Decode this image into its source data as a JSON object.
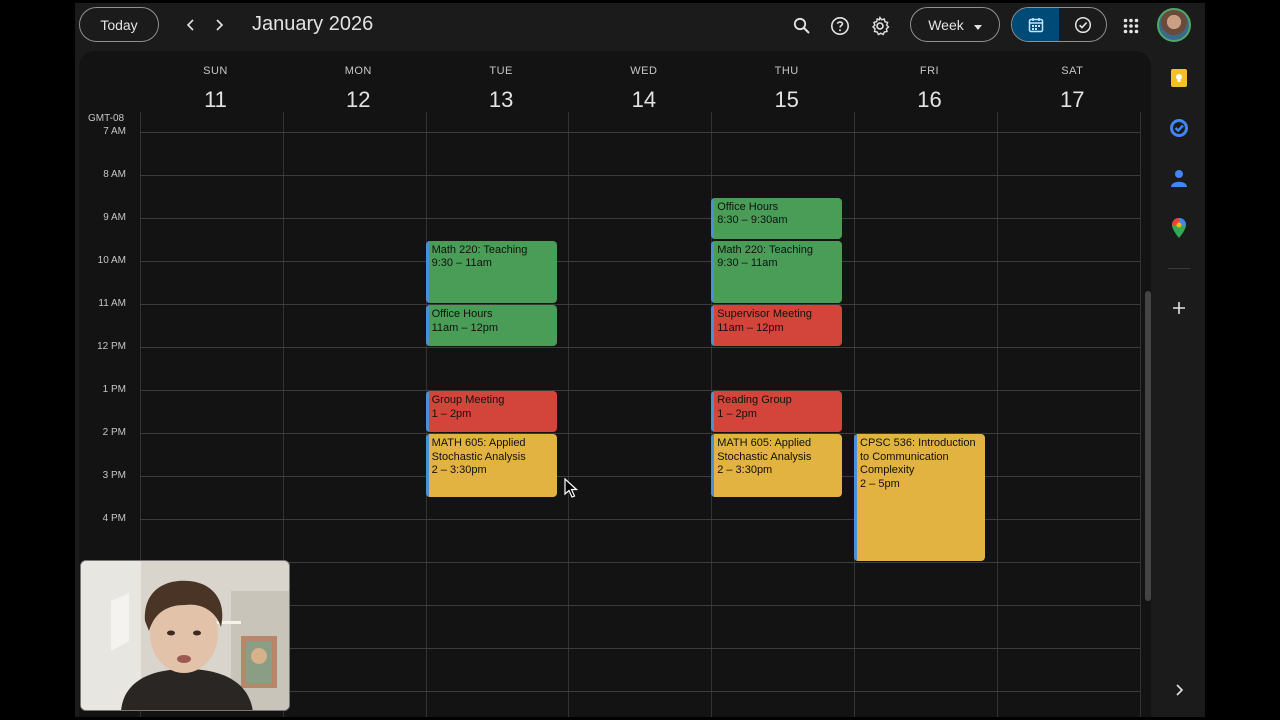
{
  "toolbar": {
    "today_label": "Today",
    "month_title": "January 2026",
    "view_label": "Week"
  },
  "calendar": {
    "timezone": "GMT-08",
    "days": [
      {
        "dow": "SUN",
        "num": "11"
      },
      {
        "dow": "MON",
        "num": "12"
      },
      {
        "dow": "TUE",
        "num": "13"
      },
      {
        "dow": "WED",
        "num": "14"
      },
      {
        "dow": "THU",
        "num": "15"
      },
      {
        "dow": "FRI",
        "num": "16"
      },
      {
        "dow": "SAT",
        "num": "17"
      }
    ],
    "hours": [
      "7 AM",
      "8 AM",
      "9 AM",
      "10 AM",
      "11 AM",
      "12 PM",
      "1 PM",
      "2 PM",
      "3 PM",
      "4 PM"
    ],
    "events": [
      {
        "day": "TUE",
        "title": "Math 220: Teaching",
        "time": "9:30 – 11am",
        "color": "#4a9d57"
      },
      {
        "day": "TUE",
        "title": "Office Hours",
        "time": "11am – 12pm",
        "color": "#4a9d57"
      },
      {
        "day": "TUE",
        "title": "Group Meeting",
        "time": "1 – 2pm",
        "color": "#d3453a"
      },
      {
        "day": "TUE",
        "title": "MATH 605: Applied Stochastic Analysis",
        "time": "2 – 3:30pm",
        "color": "#e3b341"
      },
      {
        "day": "THU",
        "title": "Office Hours",
        "time": "8:30 – 9:30am",
        "color": "#4a9d57"
      },
      {
        "day": "THU",
        "title": "Math 220: Teaching",
        "time": "9:30 – 11am",
        "color": "#4a9d57"
      },
      {
        "day": "THU",
        "title": "Supervisor Meeting",
        "time": "11am – 12pm",
        "color": "#d3453a"
      },
      {
        "day": "THU",
        "title": "Reading Group",
        "time": "1 – 2pm",
        "color": "#d3453a"
      },
      {
        "day": "THU",
        "title": "MATH 605: Applied Stochastic Analysis",
        "time": "2 – 3:30pm",
        "color": "#e3b341"
      },
      {
        "day": "FRI",
        "title": "CPSC 536: Introduction to Communication Complexity",
        "time": "2 – 5pm",
        "color": "#e3b341"
      }
    ]
  },
  "icons": {
    "top": [
      "chevron-left-icon",
      "chevron-right-icon",
      "search-icon",
      "help-icon",
      "settings-icon",
      "calendar-icon",
      "tasks-check-icon",
      "apps-grid-icon"
    ],
    "rail": [
      "keep-icon",
      "tasks-icon",
      "contacts-icon",
      "maps-icon",
      "add-icon",
      "chevron-right-icon"
    ]
  }
}
